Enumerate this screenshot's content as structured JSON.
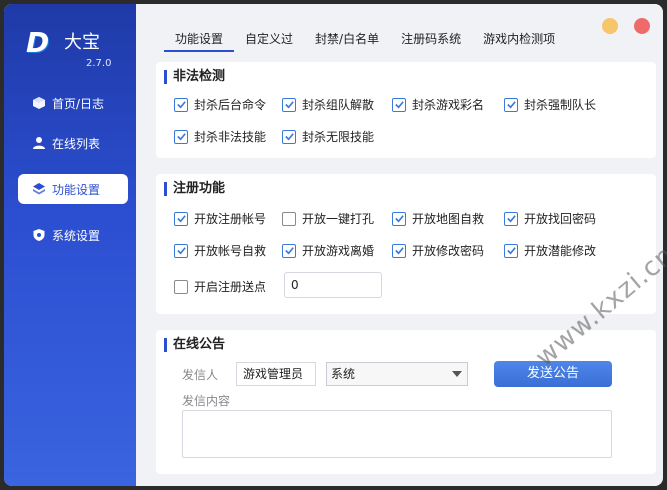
{
  "app": {
    "logo_letter": "D",
    "name": "大宝",
    "version": "2.7.0"
  },
  "sidebar": {
    "items": [
      {
        "label": "首页/日志",
        "icon": "cube-icon",
        "active": false
      },
      {
        "label": "在线列表",
        "icon": "user-icon",
        "active": false
      },
      {
        "label": "功能设置",
        "icon": "layers-icon",
        "active": true
      },
      {
        "label": "系统设置",
        "icon": "shield-gear-icon",
        "active": false
      }
    ]
  },
  "tabs": [
    {
      "label": "功能设置",
      "active": true
    },
    {
      "label": "自定义过",
      "active": false
    },
    {
      "label": "封禁/白名单",
      "active": false
    },
    {
      "label": "注册码系统",
      "active": false
    },
    {
      "label": "游戏内检测项",
      "active": false
    }
  ],
  "window_controls": {
    "minimize_color": "#f7c56a",
    "close_color": "#ef6b6b"
  },
  "illegal_detection": {
    "title": "非法检测",
    "options": [
      {
        "label": "封杀后台命令",
        "checked": true
      },
      {
        "label": "封杀组队解散",
        "checked": true
      },
      {
        "label": "封杀游戏彩名",
        "checked": true
      },
      {
        "label": "封杀强制队长",
        "checked": true
      },
      {
        "label": "封杀非法技能",
        "checked": true
      },
      {
        "label": "封杀无限技能",
        "checked": true
      }
    ]
  },
  "registration": {
    "title": "注册功能",
    "options": [
      {
        "label": "开放注册帐号",
        "checked": true
      },
      {
        "label": "开放一键打孔",
        "checked": false
      },
      {
        "label": "开放地图自救",
        "checked": true
      },
      {
        "label": "开放找回密码",
        "checked": true
      },
      {
        "label": "开放帐号自救",
        "checked": true
      },
      {
        "label": "开放游戏离婚",
        "checked": true
      },
      {
        "label": "开放修改密码",
        "checked": true
      },
      {
        "label": "开放潜能修改",
        "checked": true
      },
      {
        "label": "开启注册送点",
        "checked": false
      }
    ],
    "points_value": "0"
  },
  "announcement": {
    "title": "在线公告",
    "sender_label": "发信人",
    "sender_value": "游戏管理员",
    "channel_value": "系统",
    "send_button": "发送公告",
    "content_label": "发信内容"
  },
  "watermark": "www.kxzi.cn",
  "colors": {
    "accent": "#2c4fd1",
    "checkbox": "#3b7ad8",
    "button": "#3a6fd6"
  }
}
